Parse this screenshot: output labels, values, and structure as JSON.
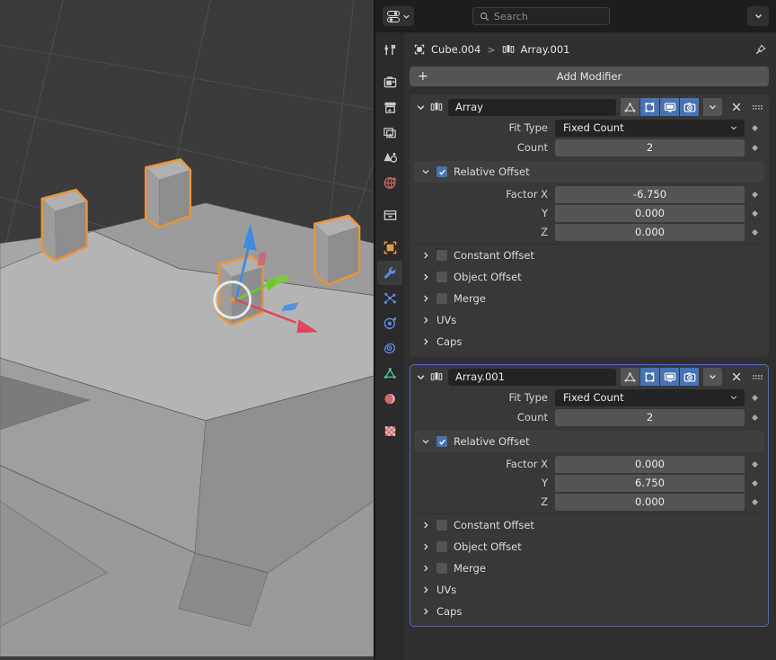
{
  "viewport": {
    "name": "3d-viewport",
    "background_color": "#3b3b3b",
    "grid_color": "#4f4f4f",
    "object_color": "#9a9a9a",
    "selection_outline_color": "#ed9336",
    "gizmo": {
      "x_axis_color": "#e04860",
      "y_axis_color": "#6fc72f",
      "z_axis_color": "#3b8ce2",
      "cursor_label": "3d-cursor"
    },
    "box_count": 4
  },
  "topbar": {
    "editor_type_icon": "properties-editor-icon",
    "editor_type_chevron": "chevron-down-icon",
    "search": {
      "icon": "search-icon",
      "placeholder": "Search",
      "value": ""
    },
    "options_chevron": "chevron-down-icon"
  },
  "rail": {
    "items": [
      {
        "name": "tool",
        "icon": "tool-icon",
        "color": "#c8c8c8",
        "active": false
      },
      {
        "name": "render",
        "icon": "render-camera-back-icon",
        "color": "#c8c8c8",
        "active": false
      },
      {
        "name": "output",
        "icon": "printer-icon",
        "color": "#c8c8c8",
        "active": false
      },
      {
        "name": "view-layer",
        "icon": "images-icon",
        "color": "#c8c8c8",
        "active": false
      },
      {
        "name": "scene",
        "icon": "scene-cone-icon",
        "color": "#c8c8c8",
        "active": false
      },
      {
        "name": "world",
        "icon": "world-globe-icon",
        "color": "#cc6666",
        "active": false
      },
      {
        "name": "collection",
        "icon": "collection-box-icon",
        "color": "#c8c8c8",
        "active": false
      },
      {
        "name": "object",
        "icon": "object-square-icon",
        "color": "#e09a4b",
        "active": false
      },
      {
        "name": "modifiers",
        "icon": "wrench-icon",
        "color": "#5b8ddb",
        "active": true
      },
      {
        "name": "particles",
        "icon": "particles-icon",
        "color": "#5b8ddb",
        "active": false
      },
      {
        "name": "physics",
        "icon": "physics-orbit-icon",
        "color": "#5b8ddb",
        "active": false
      },
      {
        "name": "constraints",
        "icon": "constraints-icon",
        "color": "#5b8ddb",
        "active": false
      },
      {
        "name": "object-data",
        "icon": "mesh-data-triangle-icon",
        "color": "#4fc48a",
        "active": false
      },
      {
        "name": "material",
        "icon": "material-sphere-icon",
        "color": "#cc6b6b",
        "active": false
      },
      {
        "name": "texture",
        "icon": "texture-checker-icon",
        "color": "#cc6b6b",
        "active": false
      }
    ]
  },
  "breadcrumb": {
    "object_icon": "object-square-icon",
    "object_name": "Cube.004",
    "separator": ">",
    "modifier_icon": "array-modifier-icon",
    "modifier_name": "Array.001",
    "pin_icon": "pin-icon"
  },
  "add_modifier": {
    "label": "Add Modifier",
    "plus_icon": "plus-icon"
  },
  "labels": {
    "fit_type": "Fit Type",
    "count": "Count",
    "relative_offset": "Relative Offset",
    "factor_x": "Factor X",
    "factor_y": "Y",
    "factor_z": "Z",
    "constant_offset": "Constant Offset",
    "object_offset": "Object Offset",
    "merge": "Merge",
    "uvs": "UVs",
    "caps": "Caps"
  },
  "modifiers": [
    {
      "name": "Array",
      "icon": "array-modifier-icon",
      "selected": false,
      "expanded": true,
      "toggles": [
        {
          "name": "show-on-cage",
          "icon": "edit-mode-cage-icon",
          "on": false
        },
        {
          "name": "show-in-edit-mode",
          "icon": "edit-mode-icon",
          "on": true
        },
        {
          "name": "show-in-viewport",
          "icon": "display-monitor-icon",
          "on": true
        },
        {
          "name": "show-in-render",
          "icon": "render-camera-icon",
          "on": true
        }
      ],
      "extras_chevron": "chevron-down-icon",
      "close_icon": "close-x-icon",
      "grip_icon": "drag-grip-icon",
      "fit_type": "Fixed Count",
      "count": "2",
      "relative_offset_enabled": true,
      "factor_x": "-6.750",
      "factor_y": "0.000",
      "factor_z": "0.000",
      "subpanels": [
        {
          "label": "Constant Offset",
          "checkbox": true,
          "checked": false
        },
        {
          "label": "Object Offset",
          "checkbox": true,
          "checked": false
        },
        {
          "label": "Merge",
          "checkbox": true,
          "checked": false
        },
        {
          "label": "UVs",
          "checkbox": false,
          "checked": false
        },
        {
          "label": "Caps",
          "checkbox": false,
          "checked": false
        }
      ]
    },
    {
      "name": "Array.001",
      "icon": "array-modifier-icon",
      "selected": true,
      "expanded": true,
      "toggles": [
        {
          "name": "show-on-cage",
          "icon": "edit-mode-cage-icon",
          "on": false
        },
        {
          "name": "show-in-edit-mode",
          "icon": "edit-mode-icon",
          "on": true
        },
        {
          "name": "show-in-viewport",
          "icon": "display-monitor-icon",
          "on": true
        },
        {
          "name": "show-in-render",
          "icon": "render-camera-icon",
          "on": true
        }
      ],
      "extras_chevron": "chevron-down-icon",
      "close_icon": "close-x-icon",
      "grip_icon": "drag-grip-icon",
      "fit_type": "Fixed Count",
      "count": "2",
      "relative_offset_enabled": true,
      "factor_x": "0.000",
      "factor_y": "6.750",
      "factor_z": "0.000",
      "subpanels": [
        {
          "label": "Constant Offset",
          "checkbox": true,
          "checked": false
        },
        {
          "label": "Object Offset",
          "checkbox": true,
          "checked": false
        },
        {
          "label": "Merge",
          "checkbox": true,
          "checked": false
        },
        {
          "label": "UVs",
          "checkbox": false,
          "checked": false
        },
        {
          "label": "Caps",
          "checkbox": false,
          "checked": false
        }
      ]
    }
  ]
}
